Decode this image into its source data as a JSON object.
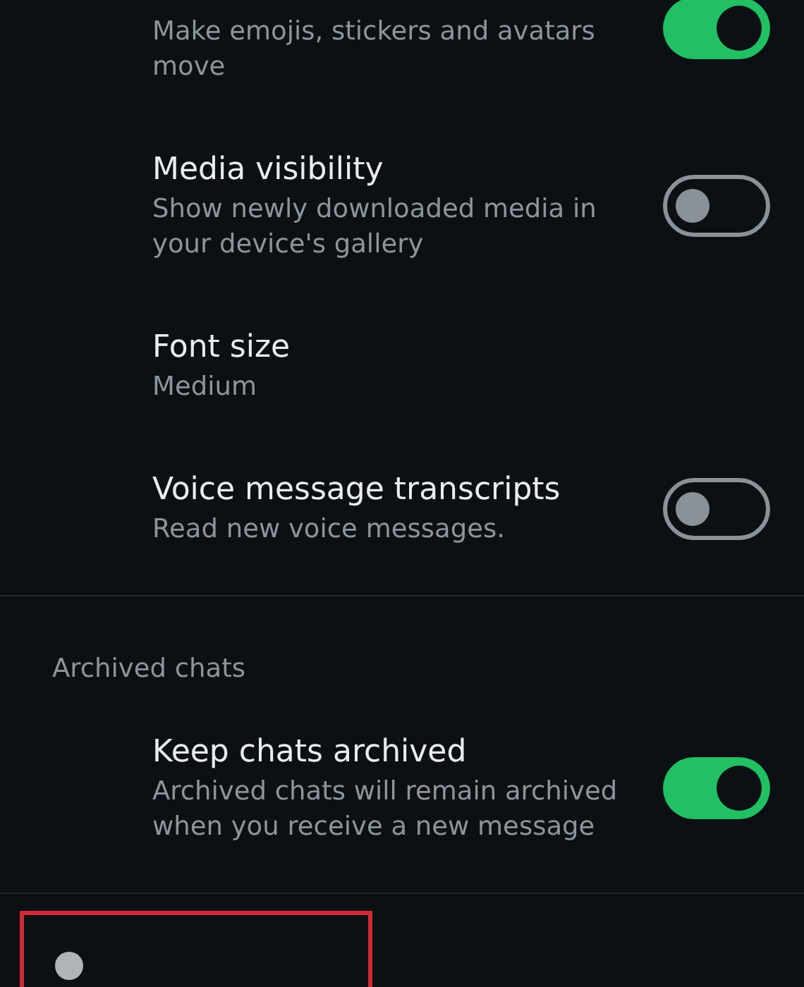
{
  "settings": [
    {
      "kind": "toggle",
      "description": "Make emojis, stickers and avatars move",
      "on": true
    },
    {
      "kind": "toggle",
      "title": "Media visibility",
      "description": "Show newly downloaded media in your device's gallery",
      "on": false
    },
    {
      "kind": "value",
      "title": "Font size",
      "description": "Medium"
    },
    {
      "kind": "toggle",
      "title": "Voice message transcripts",
      "description": "Read new voice messages.",
      "on": false
    }
  ],
  "archived_section": {
    "heading": "Archived chats",
    "settings": [
      {
        "kind": "toggle",
        "title": "Keep chats archived",
        "description": "Archived chats will remain archived when you receive a new message",
        "on": true
      }
    ]
  }
}
